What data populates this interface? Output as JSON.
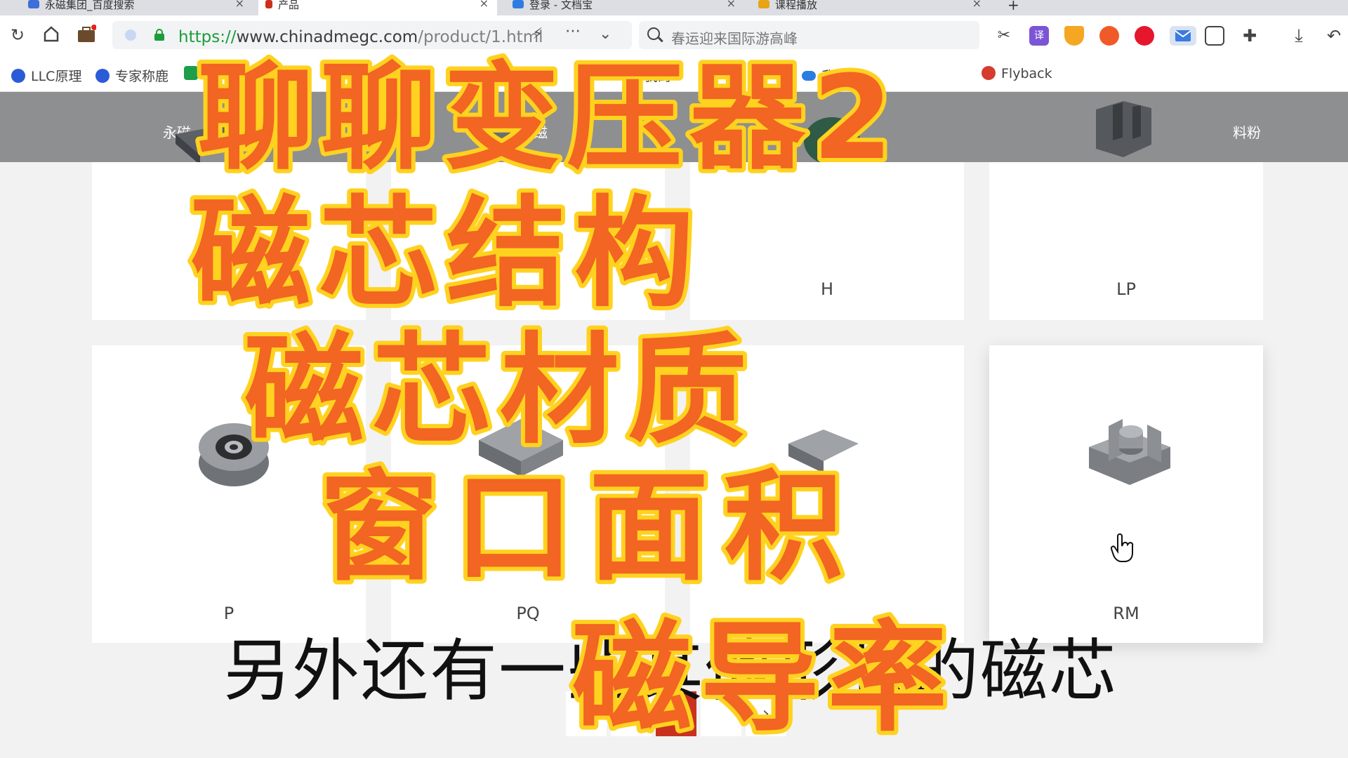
{
  "tabs": [
    {
      "label": "永磁集团_百度搜索",
      "active": false,
      "icon_color": "#3d6fd8"
    },
    {
      "label": "产品",
      "active": true,
      "icon_color": "#c9311e"
    },
    {
      "label": "登录 - 文档宝",
      "active": false,
      "icon_color": "#2f7de1"
    },
    {
      "label": "课程播放",
      "active": false,
      "icon_color": "#e8a317"
    }
  ],
  "toolbar": {
    "url_scheme": "https://",
    "url_host": "www.chinadmegc.com",
    "url_path": "/product/1.html",
    "search_placeholder": "春运迎来国际游高峰"
  },
  "bookmarks": [
    {
      "label": "LLC原理",
      "icon": "paw-icon",
      "color": "#2b5bd7"
    },
    {
      "label": "专家称鹿",
      "icon": "paw-icon",
      "color": "#2b5bd7"
    },
    {
      "label": "",
      "icon": "green-square-icon",
      "color": "#1e9e4a"
    },
    {
      "label": "我的",
      "icon": "taobao-icon",
      "color": "#ff6a00"
    },
    {
      "label": "我的",
      "icon": "cloud-icon",
      "color": "#2a7de1"
    },
    {
      "label": "Flyback",
      "icon": "flower-icon",
      "color": "#d63b2f"
    }
  ],
  "category_nav": [
    "永磁",
    "软磁",
    "料粉"
  ],
  "products_top": [
    {
      "label": ""
    },
    {
      "label": "F"
    },
    {
      "label": "H"
    },
    {
      "label": "LP"
    }
  ],
  "products_bottom": [
    {
      "label": "P"
    },
    {
      "label": "PQ"
    },
    {
      "label": ""
    },
    {
      "label": "RM"
    }
  ],
  "pagination": {
    "prev": "‹",
    "next": "›"
  },
  "subtitle": "另外还有一些其他形状的磁芯",
  "overlay_title": [
    "聊聊变压器2",
    "磁芯结构",
    "磁芯材质",
    "窗口面积",
    "磁导率"
  ],
  "colors": {
    "overlay_fill": "#f26522",
    "overlay_stroke": "#ffd21f",
    "brand_red": "#c9311e",
    "nav_gray": "#8e8f91"
  }
}
